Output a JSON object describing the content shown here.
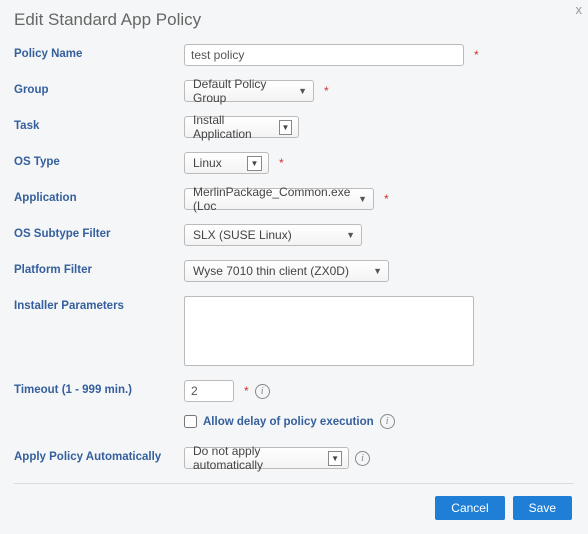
{
  "dialog": {
    "title": "Edit Standard App Policy",
    "close": "x"
  },
  "labels": {
    "policyName": "Policy Name",
    "group": "Group",
    "task": "Task",
    "osType": "OS Type",
    "application": "Application",
    "osSubtype": "OS Subtype Filter",
    "platform": "Platform Filter",
    "installer": "Installer Parameters",
    "timeout": "Timeout (1 - 999 min.)",
    "allowDelay": "Allow delay of policy execution",
    "applyAuto": "Apply Policy Automatically"
  },
  "values": {
    "policyName": "test policy",
    "group": "Default Policy Group",
    "task": "Install Application",
    "osType": "Linux",
    "application": "MerlinPackage_Common.exe (Loc",
    "osSubtype": "SLX (SUSE Linux)",
    "platform": "Wyse 7010 thin client (ZX0D)",
    "installer": "",
    "timeout": "2",
    "allowDelay": false,
    "applyAuto": "Do not apply automatically"
  },
  "buttons": {
    "cancel": "Cancel",
    "save": "Save"
  }
}
